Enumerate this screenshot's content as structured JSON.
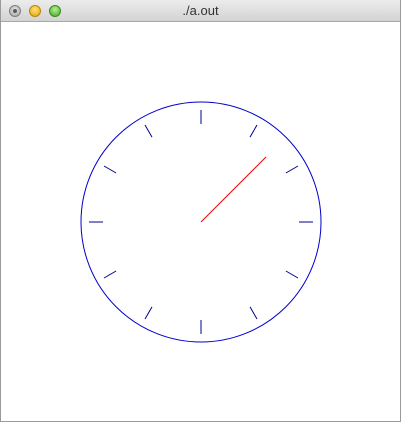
{
  "window": {
    "title": "./a.out"
  },
  "clock": {
    "face_color": "#0000cc",
    "tick_color": "#00008b",
    "hand_color": "#ff0000",
    "tick_count": 12,
    "hand_position_hours": 1.5
  }
}
